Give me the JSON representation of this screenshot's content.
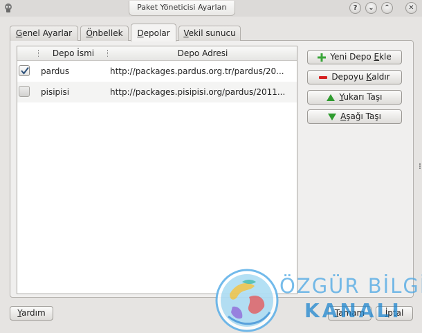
{
  "window": {
    "title": "Paket Yöneticisi Ayarları",
    "buttons": {
      "help": "?",
      "minimize": "⌄",
      "maximize": "⌃",
      "close": "✕"
    }
  },
  "tabs": [
    {
      "label_u": "G",
      "label_rest": "enel Ayarlar",
      "active": false
    },
    {
      "label_u": "Ö",
      "label_rest": "nbellek",
      "active": false
    },
    {
      "label_u": "D",
      "label_rest": "epolar",
      "active": true
    },
    {
      "label_u": "V",
      "label_rest": "ekil sunucu",
      "active": false
    }
  ],
  "repo_table": {
    "columns": [
      "Depo İsmi",
      "Depo Adresi"
    ],
    "rows": [
      {
        "checked": true,
        "name": "pardus",
        "url": "http://packages.pardus.org.tr/pardus/20..."
      },
      {
        "checked": false,
        "name": "pisipisi",
        "url": "http://packages.pisipisi.org/pardus/2011..."
      }
    ]
  },
  "actions": {
    "add": {
      "pre": "Yeni Depo ",
      "u": "E",
      "post": "kle",
      "icon": "plus-icon",
      "color": "#3aa63a"
    },
    "remove": {
      "pre": "Depoyu ",
      "u": "K",
      "post": "aldır",
      "icon": "minus-icon",
      "color": "#d62020"
    },
    "up": {
      "pre": "",
      "u": "Y",
      "post": "ukarı Taşı",
      "icon": "arrow-up-icon",
      "color": "#2f9b2f"
    },
    "down": {
      "pre": "",
      "u": "A",
      "post": "şağı Taşı",
      "icon": "arrow-down-icon",
      "color": "#2f9b2f"
    }
  },
  "footer": {
    "help": {
      "u": "Y",
      "post": "ardım"
    },
    "ok": {
      "u": "T",
      "post": "amam"
    },
    "cancel": {
      "u": "İ",
      "post": "ptal"
    }
  },
  "watermark": {
    "line1": "ÖZGÜR BİLGİ",
    "line2": "KANALI"
  }
}
